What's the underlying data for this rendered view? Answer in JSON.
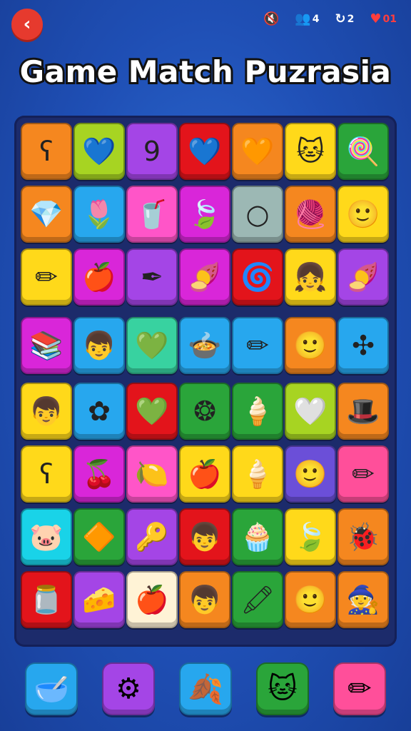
{
  "header": {
    "title": "Game Match Puzrasia",
    "back_glyph": "‹",
    "status": [
      {
        "name": "sound-status",
        "glyph": "🔇",
        "value": ""
      },
      {
        "name": "players-status",
        "glyph": "👥",
        "value": "4"
      },
      {
        "name": "retry-status",
        "glyph": "↻",
        "value": "2"
      },
      {
        "name": "lives-status",
        "glyph": "♥",
        "value": "01"
      }
    ]
  },
  "colors": {
    "orange": "#f5871f",
    "lime": "#a7d422",
    "purple": "#a445e6",
    "red": "#e3141b",
    "yellow": "#ffd91a",
    "green": "#2aa53a",
    "sky": "#27a7ee",
    "pink": "#ff55c8",
    "magenta": "#d926d9",
    "grey": "#9cb8b4",
    "teal": "#38d2a0",
    "cyan": "#19d3e8",
    "cream": "#fff3d6",
    "violet": "#6b4fd8",
    "rose": "#ff4f9a"
  },
  "grid": [
    [
      {
        "icon": "hook-icon",
        "glyph": "ʕ",
        "color": "orange"
      },
      {
        "icon": "heart-icon",
        "glyph": "💙",
        "color": "lime"
      },
      {
        "icon": "number-nine-icon",
        "glyph": "9",
        "color": "purple"
      },
      {
        "icon": "heart-icon",
        "glyph": "💙",
        "color": "red"
      },
      {
        "icon": "heart-icon",
        "glyph": "🧡",
        "color": "orange"
      },
      {
        "icon": "cat-face-icon",
        "glyph": "🐱",
        "color": "yellow"
      },
      {
        "icon": "lollipop-icon",
        "glyph": "🍭",
        "color": "green"
      }
    ],
    [
      {
        "icon": "gem-icon",
        "glyph": "💎",
        "color": "orange"
      },
      {
        "icon": "flower-icon",
        "glyph": "🌷",
        "color": "sky"
      },
      {
        "icon": "cup-icon",
        "glyph": "🥤",
        "color": "pink"
      },
      {
        "icon": "leaf-icon",
        "glyph": "🍃",
        "color": "magenta"
      },
      {
        "icon": "ring-icon",
        "glyph": "○",
        "color": "grey"
      },
      {
        "icon": "yarn-icon",
        "glyph": "🧶",
        "color": "orange"
      },
      {
        "icon": "face-icon",
        "glyph": "🙂",
        "color": "yellow"
      }
    ],
    [
      {
        "icon": "pencil-icon",
        "glyph": "✏",
        "color": "yellow"
      },
      {
        "icon": "apple-icon",
        "glyph": "🍎",
        "color": "magenta"
      },
      {
        "icon": "pen-icon",
        "glyph": "✒",
        "color": "purple"
      },
      {
        "icon": "radish-icon",
        "glyph": "🍠",
        "color": "magenta"
      },
      {
        "icon": "spiral-icon",
        "glyph": "🌀",
        "color": "red"
      },
      {
        "icon": "girl-face-icon",
        "glyph": "👧",
        "color": "yellow"
      },
      {
        "icon": "radish-icon",
        "glyph": "🍠",
        "color": "purple"
      }
    ],
    [
      {
        "icon": "book-stack-icon",
        "glyph": "📚",
        "color": "magenta"
      },
      {
        "icon": "boy-face-icon",
        "glyph": "👦",
        "color": "sky"
      },
      {
        "icon": "gem-icon",
        "glyph": "💚",
        "color": "teal"
      },
      {
        "icon": "pot-icon",
        "glyph": "🍲",
        "color": "sky"
      },
      {
        "icon": "pencil-icon",
        "glyph": "✏",
        "color": "sky"
      },
      {
        "icon": "face-icon",
        "glyph": "🙂",
        "color": "orange"
      },
      {
        "icon": "molecule-icon",
        "glyph": "✣",
        "color": "sky"
      }
    ],
    [
      {
        "icon": "boy-face-icon",
        "glyph": "👦",
        "color": "yellow"
      },
      {
        "icon": "flower-icon",
        "glyph": "✿",
        "color": "sky"
      },
      {
        "icon": "heart-icon",
        "glyph": "💚",
        "color": "red"
      },
      {
        "icon": "wreath-icon",
        "glyph": "❂",
        "color": "green"
      },
      {
        "icon": "ice-cream-icon",
        "glyph": "🍦",
        "color": "green"
      },
      {
        "icon": "heart-icon",
        "glyph": "🤍",
        "color": "lime"
      },
      {
        "icon": "witch-hat-icon",
        "glyph": "🎩",
        "color": "orange"
      }
    ],
    [
      {
        "icon": "hook-icon",
        "glyph": "ʕ",
        "color": "yellow"
      },
      {
        "icon": "cherries-icon",
        "glyph": "🍒",
        "color": "magenta"
      },
      {
        "icon": "lemon-icon",
        "glyph": "🍋",
        "color": "pink"
      },
      {
        "icon": "apple-icon",
        "glyph": "🍎",
        "color": "yellow"
      },
      {
        "icon": "ice-cream-icon",
        "glyph": "🍦",
        "color": "yellow"
      },
      {
        "icon": "face-icon",
        "glyph": "🙂",
        "color": "violet"
      },
      {
        "icon": "pencil-icon",
        "glyph": "✏",
        "color": "rose"
      }
    ],
    [
      {
        "icon": "monster-face-icon",
        "glyph": "🐷",
        "color": "cyan"
      },
      {
        "icon": "gem-icon",
        "glyph": "🔶",
        "color": "green"
      },
      {
        "icon": "pacifier-icon",
        "glyph": "🔑",
        "color": "purple"
      },
      {
        "icon": "boy-face-icon",
        "glyph": "👦",
        "color": "red"
      },
      {
        "icon": "cupcake-icon",
        "glyph": "🧁",
        "color": "green"
      },
      {
        "icon": "leaf-icon",
        "glyph": "🍃",
        "color": "yellow"
      },
      {
        "icon": "bug-icon",
        "glyph": "🐞",
        "color": "orange"
      }
    ],
    [
      {
        "icon": "jar-icon",
        "glyph": "🫙",
        "color": "red"
      },
      {
        "icon": "cheese-icon",
        "glyph": "🧀",
        "color": "purple"
      },
      {
        "icon": "apple-icon",
        "glyph": "🍎",
        "color": "cream"
      },
      {
        "icon": "boy-face-icon",
        "glyph": "👦",
        "color": "orange"
      },
      {
        "icon": "pen-icon",
        "glyph": "🖍",
        "color": "green"
      },
      {
        "icon": "face-icon",
        "glyph": "🙂",
        "color": "orange"
      },
      {
        "icon": "witch-hat-icon",
        "glyph": "🧙",
        "color": "orange"
      }
    ]
  ],
  "powerups": [
    {
      "name": "powerup-bowl",
      "icon": "bowl-icon",
      "glyph": "🥣",
      "color": "sky"
    },
    {
      "name": "powerup-gear",
      "icon": "gear-icon",
      "glyph": "⚙",
      "color": "purple"
    },
    {
      "name": "powerup-leaf",
      "icon": "leaf-icon",
      "glyph": "🍂",
      "color": "sky"
    },
    {
      "name": "powerup-cat",
      "icon": "cat-face-icon",
      "glyph": "🐱",
      "color": "green"
    },
    {
      "name": "powerup-pencil",
      "icon": "pencil-icon",
      "glyph": "✏",
      "color": "rose"
    }
  ]
}
